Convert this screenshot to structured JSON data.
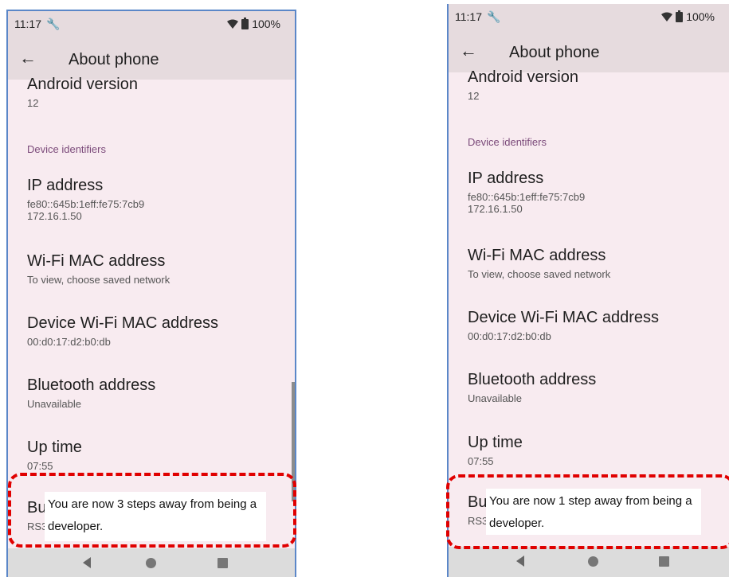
{
  "colors": {
    "highlight": "#e00000",
    "frame": "#5b87c8",
    "background": "#f8ebf0",
    "category": "#7b4a7a"
  },
  "left": {
    "status": {
      "time": "11:17",
      "wrench": "🔧",
      "battery": "100%",
      "wifi_icon": "wifi-icon"
    },
    "header": {
      "title": "About phone",
      "back": "←"
    },
    "android": {
      "title": "Android version",
      "value": "12"
    },
    "category": "Device identifiers",
    "ip": {
      "title": "IP address",
      "line1": "fe80::645b:1eff:fe75:7cb9",
      "line2": "172.16.1.50"
    },
    "wifi_mac": {
      "title": "Wi-Fi MAC address",
      "value": "To view, choose saved network"
    },
    "device_mac": {
      "title": "Device Wi-Fi MAC address",
      "value": "00:d0:17:d2:b0:db"
    },
    "bluetooth": {
      "title": "Bluetooth address",
      "value": "Unavailable"
    },
    "uptime": {
      "title": "Up time",
      "value": "07:55"
    },
    "build": {
      "title_partial": "Bu",
      "value_partial": "RS3"
    },
    "toast": {
      "line1": "You are now 3 steps away from being a",
      "line2": "developer."
    }
  },
  "right": {
    "status": {
      "time": "11:17",
      "wrench": "🔧",
      "battery": "100%",
      "wifi_icon": "wifi-icon"
    },
    "header": {
      "title": "About phone",
      "back": "←"
    },
    "android": {
      "title": "Android version",
      "value": "12"
    },
    "category": "Device identifiers",
    "ip": {
      "title": "IP address",
      "line1": "fe80::645b:1eff:fe75:7cb9",
      "line2": "172.16.1.50"
    },
    "wifi_mac": {
      "title": "Wi-Fi MAC address",
      "value": "To view, choose saved network"
    },
    "device_mac": {
      "title": "Device Wi-Fi MAC address",
      "value": "00:d0:17:d2:b0:db"
    },
    "bluetooth": {
      "title": "Bluetooth address",
      "value": "Unavailable"
    },
    "uptime": {
      "title": "Up time",
      "value": "07:55"
    },
    "build": {
      "title_partial": "Bu",
      "value_partial": "RS3"
    },
    "toast": {
      "line1": "You are now  1 step  away from being a",
      "line2": "developer."
    }
  }
}
